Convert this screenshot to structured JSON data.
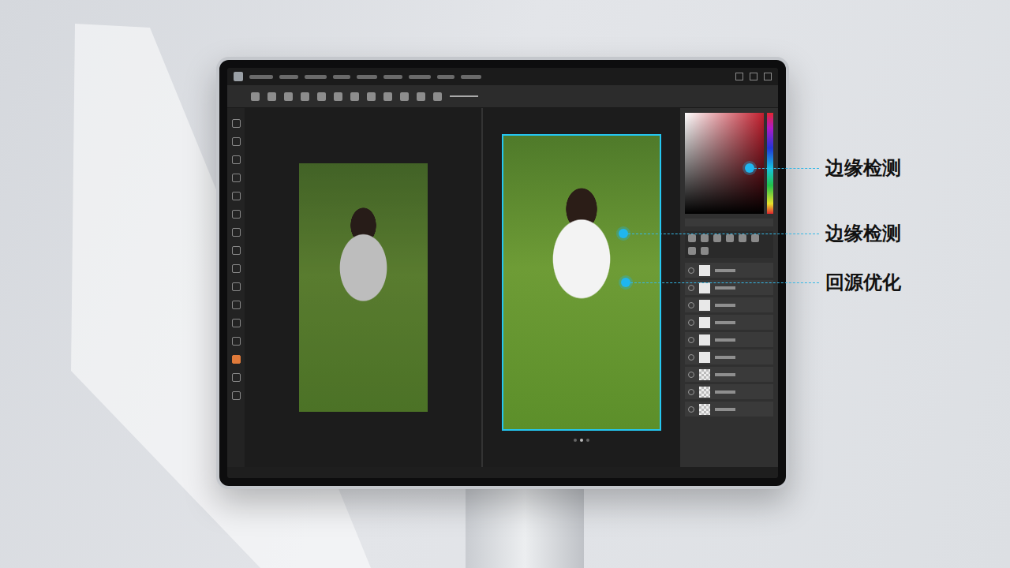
{
  "callouts": [
    {
      "label": "边缘检测"
    },
    {
      "label": "边缘检测"
    },
    {
      "label": "回源优化"
    }
  ]
}
